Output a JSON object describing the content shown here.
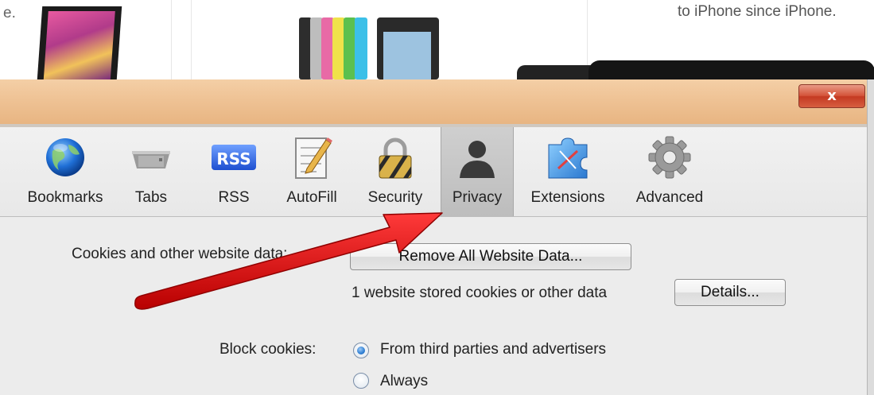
{
  "background_page": {
    "left_text": "e.",
    "right_text": "to iPhone since iPhone."
  },
  "dialog": {
    "close_label": "x"
  },
  "toolbar": {
    "items": [
      {
        "label": "Bookmarks",
        "icon": "globe-icon"
      },
      {
        "label": "Tabs",
        "icon": "tabs-icon"
      },
      {
        "label": "RSS",
        "icon": "rss-icon"
      },
      {
        "label": "AutoFill",
        "icon": "autofill-icon"
      },
      {
        "label": "Security",
        "icon": "lock-icon"
      },
      {
        "label": "Privacy",
        "icon": "person-icon",
        "selected": true
      },
      {
        "label": "Extensions",
        "icon": "puzzle-icon"
      },
      {
        "label": "Advanced",
        "icon": "gear-icon"
      }
    ],
    "rss_badge": "RSS"
  },
  "privacy": {
    "cookies_label": "Cookies and other website data:",
    "remove_button": "Remove All Website Data...",
    "stored_text": "1 website stored cookies or other data",
    "details_button": "Details...",
    "block_label": "Block cookies:",
    "options": [
      {
        "label": "From third parties and advertisers",
        "checked": true
      },
      {
        "label": "Always",
        "checked": false
      }
    ]
  },
  "colors": {
    "titlebar": "#eec193",
    "close_button": "#c43a22",
    "annotation_arrow": "#e01010",
    "selected_tab": "#bdbdbd"
  }
}
